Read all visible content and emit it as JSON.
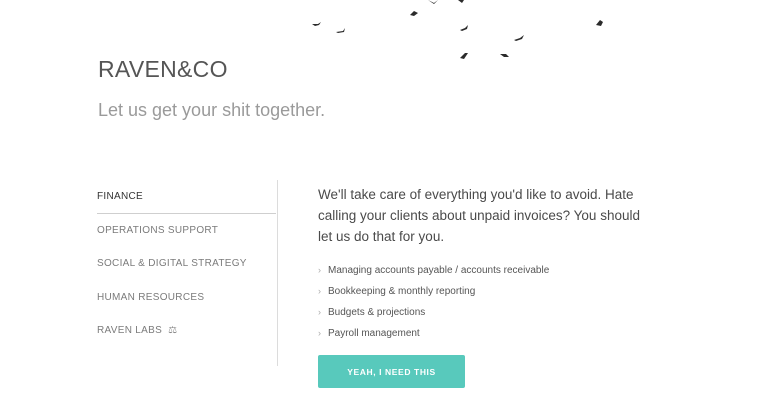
{
  "header": {
    "brand": "RAVEN&CO",
    "tagline": "Let us get your shit together."
  },
  "nav": {
    "items": [
      {
        "label": "FINANCE",
        "active": true
      },
      {
        "label": "OPERATIONS SUPPORT",
        "active": false
      },
      {
        "label": "SOCIAL & DIGITAL STRATEGY",
        "active": false
      },
      {
        "label": "HUMAN RESOURCES",
        "active": false
      },
      {
        "label": "RAVEN LABS",
        "active": false,
        "icon": "flask-icon"
      }
    ]
  },
  "content": {
    "intro": "We'll take care of everything you'd like to avoid. Hate calling your clients about unpaid invoices? You should let us do that for you.",
    "features": [
      "Managing accounts payable / accounts receivable",
      "Bookkeeping & monthly reporting",
      "Budgets & projections",
      "Payroll management"
    ],
    "cta_label": "YEAH, I NEED THIS"
  },
  "colors": {
    "accent": "#58c9bc",
    "text": "#555555",
    "muted": "#9a9a9a"
  }
}
